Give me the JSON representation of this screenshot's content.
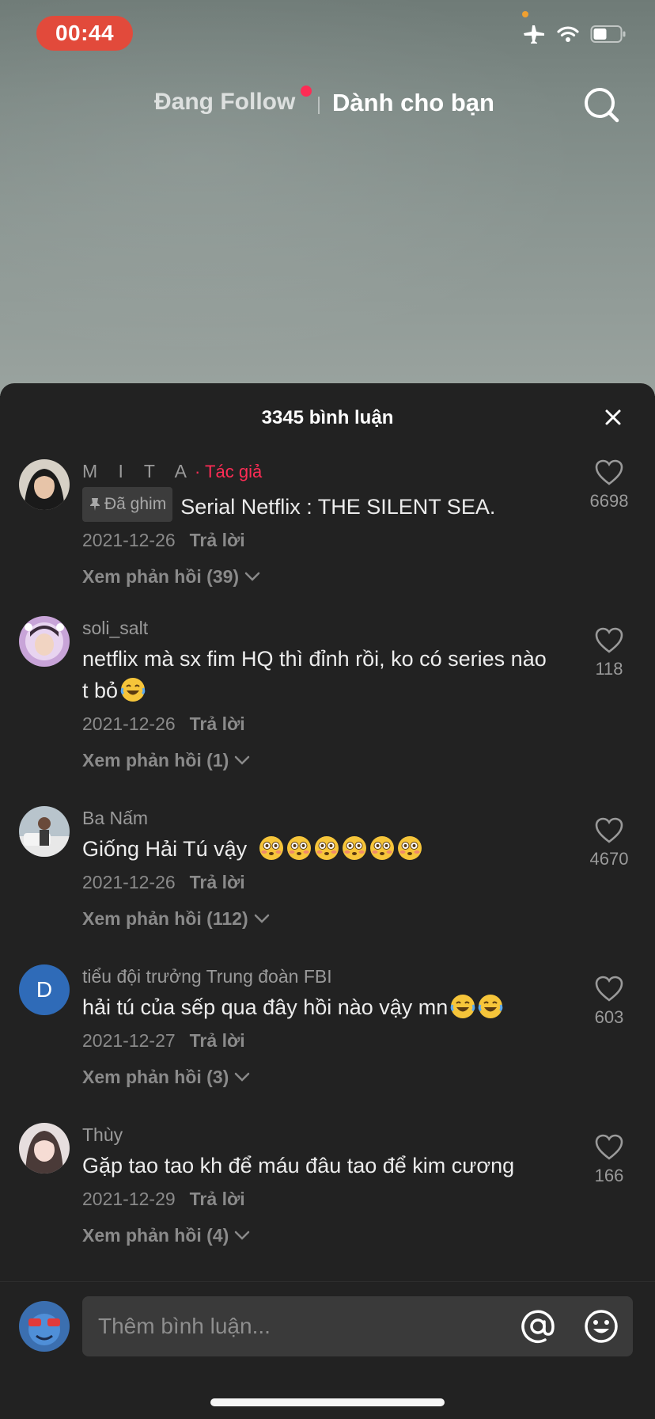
{
  "status_bar": {
    "time": "00:44"
  },
  "top_nav": {
    "following_label": "Đang Follow",
    "for_you_label": "Dành cho bạn",
    "accent_color": "#fe2c55"
  },
  "sheet": {
    "title": "3345 bình luận"
  },
  "comments": [
    {
      "username": "M I T A",
      "author_tag": "· Tác giả",
      "pinned_label": "Đã ghim",
      "text": "Serial Netflix : THE SILENT SEA.",
      "date": "2021-12-26",
      "reply_label": "Trả lời",
      "replies_label": "Xem phản hồi (39)",
      "likes": "6698"
    },
    {
      "username": "soli_salt",
      "text": "netflix mà sx fim HQ thì đỉnh rồi, ko có series nào t bỏ",
      "date": "2021-12-26",
      "reply_label": "Trả lời",
      "replies_label": "Xem phản hồi (1)",
      "likes": "118"
    },
    {
      "username": "Ba Nấm",
      "text": "Giống Hải Tú vậy",
      "date": "2021-12-26",
      "reply_label": "Trả lời",
      "replies_label": "Xem phản hồi (112)",
      "likes": "4670"
    },
    {
      "username": "tiểu đội trưởng Trung đoàn FBI",
      "avatar_letter": "D",
      "text": "hải tú của sếp qua đây hồi nào vậy mn",
      "date": "2021-12-27",
      "reply_label": "Trả lời",
      "replies_label": "Xem phản hồi (3)",
      "likes": "603"
    },
    {
      "username": "Thùy",
      "text": "Gặp tao tao kh để máu đâu tao để kim cương",
      "date": "2021-12-29",
      "reply_label": "Trả lời",
      "replies_label": "Xem phản hồi (4)",
      "likes": "166"
    }
  ],
  "input": {
    "placeholder": "Thêm bình luận..."
  }
}
